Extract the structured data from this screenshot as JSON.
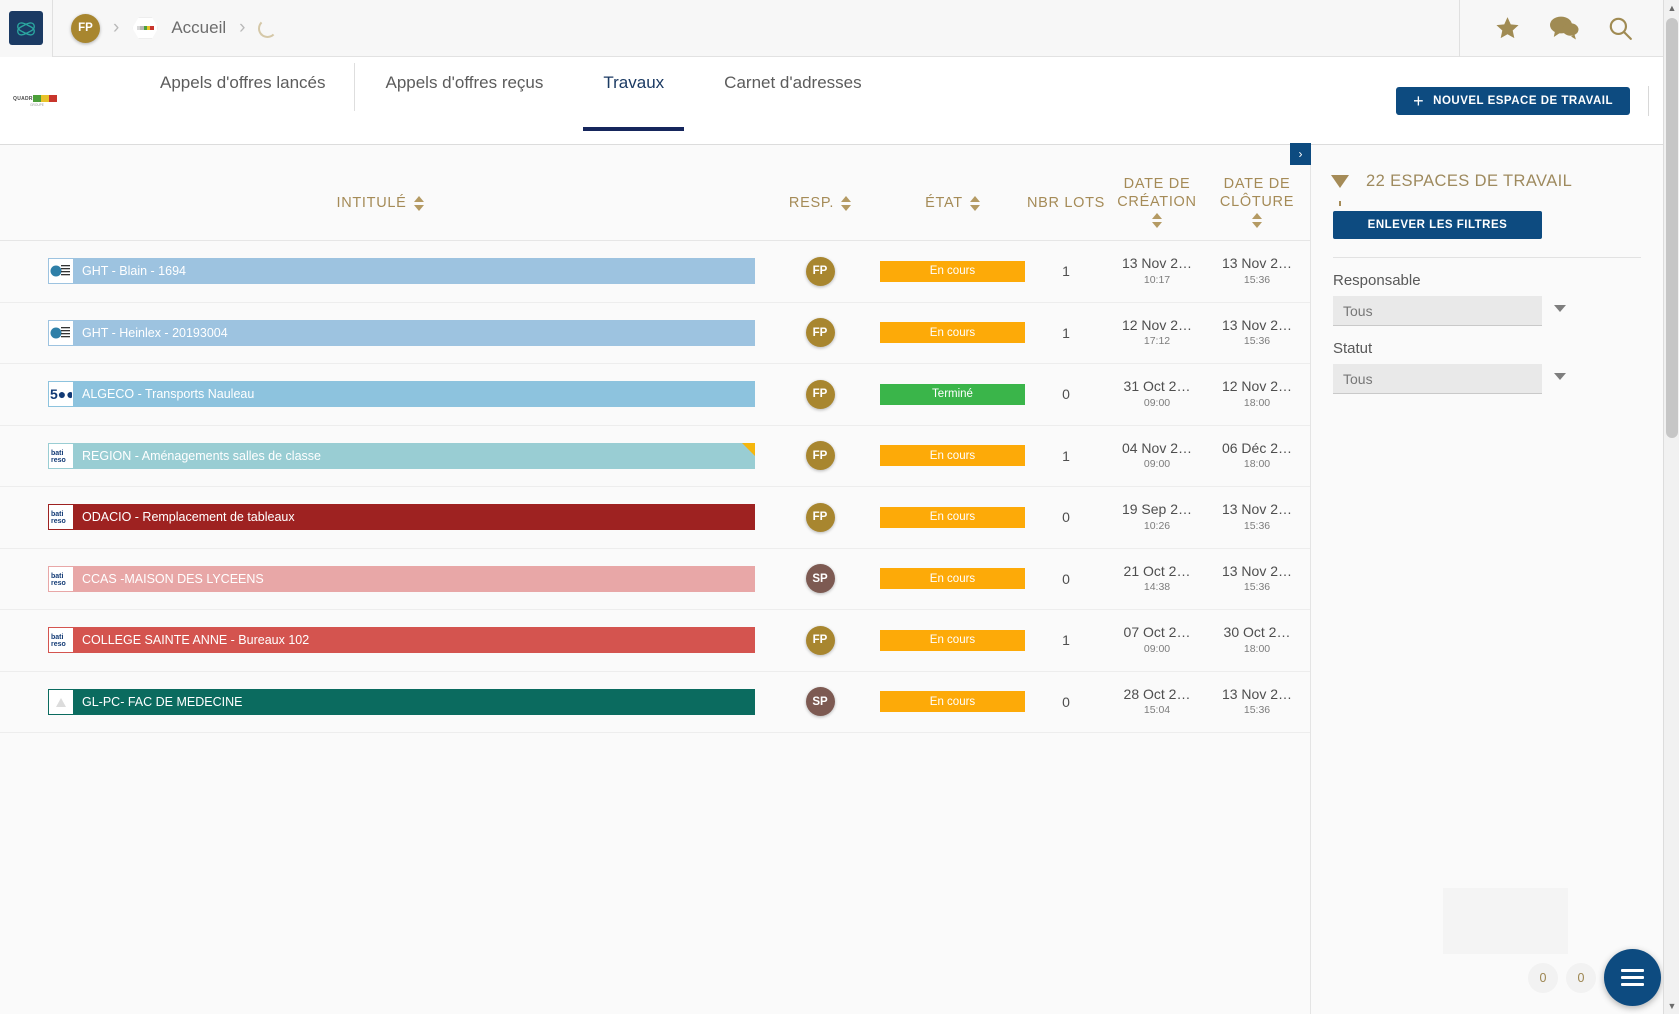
{
  "topbar": {
    "logo_name": "app-logo",
    "user_initials": "FP",
    "breadcrumb_home": "Accueil",
    "icons": [
      "star-icon",
      "chat-icon",
      "search-icon"
    ]
  },
  "tabs": [
    {
      "label": "Appels d'offres lancés",
      "active": false
    },
    {
      "label": "Appels d'offres reçus",
      "active": false
    },
    {
      "label": "Travaux",
      "active": true
    },
    {
      "label": "Carnet d'adresses",
      "active": false
    }
  ],
  "toolbar": {
    "new_workspace_label": "NOUVEL ESPACE DE TRAVAIL",
    "plus": "+"
  },
  "brandmark": {
    "text_left": "QUADR",
    "text_right": "NOV"
  },
  "table": {
    "columns": [
      {
        "key": "intitule",
        "label": "INTITULÉ",
        "sortable": true
      },
      {
        "key": "resp",
        "label": "RESP.",
        "sortable": true
      },
      {
        "key": "etat",
        "label": "ÉTAT",
        "sortable": true
      },
      {
        "key": "nbr_lots",
        "label": "NBR LOTS",
        "sortable": false
      },
      {
        "key": "date_creation",
        "label_line1": "DATE DE",
        "label_line2": "CRÉATION",
        "sortable": true
      },
      {
        "key": "date_cloture",
        "label_line1": "DATE DE",
        "label_line2": "CLÔTURE",
        "sortable": true
      }
    ],
    "rows": [
      {
        "title": "GHT - Blain - 1694",
        "color": "#9dc3e0",
        "logo": "ght-logo",
        "flag": false,
        "resp": "FP",
        "resp_color": "#a8862f",
        "etat": "En cours",
        "etat_color": "#fdaa08",
        "nbr_lots": "1",
        "date_creation": "13 Nov 2…",
        "heure_creation": "10:17",
        "date_cloture": "13 Nov 2…",
        "heure_cloture": "15:36"
      },
      {
        "title": "GHT - Heinlex - 20193004",
        "color": "#9dc3e0",
        "logo": "ght-logo",
        "flag": false,
        "resp": "FP",
        "resp_color": "#a8862f",
        "etat": "En cours",
        "etat_color": "#fdaa08",
        "nbr_lots": "1",
        "date_creation": "12 Nov 2…",
        "heure_creation": "17:12",
        "date_cloture": "13 Nov 2…",
        "heure_cloture": "15:36"
      },
      {
        "title": "ALGECO - Transports Nauleau",
        "color": "#8dc3de",
        "logo": "algeco-logo",
        "flag": false,
        "resp": "FP",
        "resp_color": "#a8862f",
        "etat": "Terminé",
        "etat_color": "#3ab54a",
        "nbr_lots": "0",
        "date_creation": "31 Oct 2…",
        "heure_creation": "09:00",
        "date_cloture": "12 Nov 2…",
        "heure_cloture": "18:00"
      },
      {
        "title": "REGION - Aménagements salles de classe",
        "color": "#99cdd3",
        "logo": "batireso-logo",
        "flag": true,
        "resp": "FP",
        "resp_color": "#a8862f",
        "etat": "En cours",
        "etat_color": "#fdaa08",
        "nbr_lots": "1",
        "date_creation": "04 Nov 2…",
        "heure_creation": "09:00",
        "date_cloture": "06 Déc 2…",
        "heure_cloture": "18:00"
      },
      {
        "title": "ODACIO - Remplacement de tableaux",
        "color": "#9e2221",
        "logo": "batireso-logo",
        "flag": false,
        "resp": "FP",
        "resp_color": "#a8862f",
        "etat": "En cours",
        "etat_color": "#fdaa08",
        "nbr_lots": "0",
        "date_creation": "19 Sep 2…",
        "heure_creation": "10:26",
        "date_cloture": "13 Nov 2…",
        "heure_cloture": "15:36"
      },
      {
        "title": "CCAS -MAISON DES LYCEENS",
        "color": "#e8a7a7",
        "logo": "batireso-logo",
        "flag": false,
        "resp": "SP",
        "resp_color": "#7d5a52",
        "etat": "En cours",
        "etat_color": "#fdaa08",
        "nbr_lots": "0",
        "date_creation": "21 Oct 2…",
        "heure_creation": "14:38",
        "date_cloture": "13 Nov 2…",
        "heure_cloture": "15:36"
      },
      {
        "title": "COLLEGE SAINTE ANNE - Bureaux 102",
        "color": "#d4544f",
        "logo": "batireso-logo",
        "flag": false,
        "resp": "FP",
        "resp_color": "#a8862f",
        "etat": "En cours",
        "etat_color": "#fdaa08",
        "nbr_lots": "1",
        "date_creation": "07 Oct 2…",
        "heure_creation": "09:00",
        "date_cloture": "30 Oct 2…",
        "heure_cloture": "18:00"
      },
      {
        "title": "GL-PC- FAC DE MEDECINE",
        "color": "#0b6b5f",
        "logo": "generic-logo",
        "flag": false,
        "resp": "SP",
        "resp_color": "#7d5a52",
        "etat": "En cours",
        "etat_color": "#fdaa08",
        "nbr_lots": "0",
        "date_creation": "28 Oct 2…",
        "heure_creation": "15:04",
        "date_cloture": "13 Nov 2…",
        "heure_cloture": "15:36"
      }
    ]
  },
  "filter_panel": {
    "collapse_label": "›",
    "title": "22 ESPACES DE TRAVAIL",
    "remove_filters_label": "ENLEVER LES FILTRES",
    "responsable_label": "Responsable",
    "responsable_value": "Tous",
    "statut_label": "Statut",
    "statut_value": "Tous"
  },
  "footer": {
    "counter_left": "0",
    "counter_right": "0",
    "fab_name": "menu-fab"
  },
  "colors": {
    "brand_blue": "#0d4b80",
    "gold": "#a58b57",
    "accent_nav": "#16265c"
  }
}
